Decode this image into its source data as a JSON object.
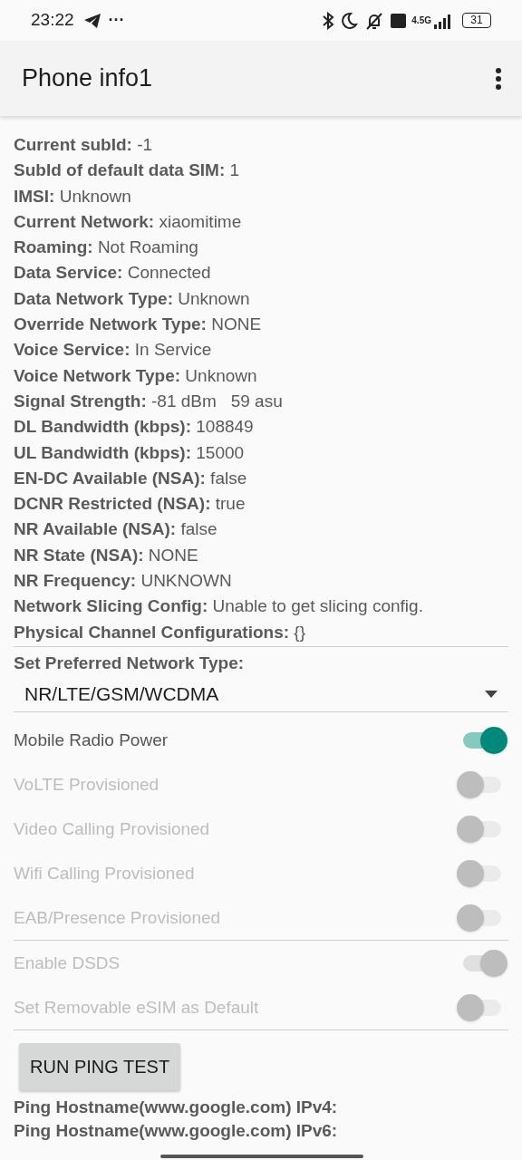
{
  "status_bar": {
    "time": "23:22",
    "more": "···",
    "battery": "31",
    "network": "4.5G"
  },
  "app_bar": {
    "title": "Phone info1"
  },
  "info": [
    {
      "label": "Current subId:",
      "value": "-1"
    },
    {
      "label": "SubId of default data SIM:",
      "value": "1"
    },
    {
      "label": "IMSI:",
      "value": "Unknown"
    },
    {
      "label": "Current Network:",
      "value": "xiaomitime"
    },
    {
      "label": "Roaming:",
      "value": "Not Roaming"
    },
    {
      "label": "Data Service:",
      "value": "Connected"
    },
    {
      "label": "Data Network Type:",
      "value": "Unknown"
    },
    {
      "label": "Override Network Type:",
      "value": "NONE"
    },
    {
      "label": "Voice Service:",
      "value": "In Service"
    },
    {
      "label": "Voice Network Type:",
      "value": "Unknown"
    },
    {
      "label": "Signal Strength:",
      "value": "-81 dBm   59 asu"
    },
    {
      "label": "DL Bandwidth (kbps):",
      "value": "108849"
    },
    {
      "label": "UL Bandwidth (kbps):",
      "value": "15000"
    },
    {
      "label": "EN-DC Available (NSA):",
      "value": "false"
    },
    {
      "label": "DCNR Restricted (NSA):",
      "value": "true"
    },
    {
      "label": "NR Available (NSA):",
      "value": "false"
    },
    {
      "label": "NR State (NSA):",
      "value": "NONE"
    },
    {
      "label": "NR Frequency:",
      "value": "UNKNOWN"
    },
    {
      "label": "Network Slicing Config:",
      "value": "Unable to get slicing config."
    },
    {
      "label": "Physical Channel Configurations:",
      "value": "{}"
    }
  ],
  "preferred_network": {
    "label": "Set Preferred Network Type:",
    "value": "NR/LTE/GSM/WCDMA"
  },
  "switch_groups": [
    [
      {
        "label": "Mobile Radio Power",
        "on": true,
        "disabled": false
      },
      {
        "label": "VoLTE Provisioned",
        "on": false,
        "disabled": true
      },
      {
        "label": "Video Calling Provisioned",
        "on": false,
        "disabled": true
      },
      {
        "label": "Wifi Calling Provisioned",
        "on": false,
        "disabled": true
      },
      {
        "label": "EAB/Presence Provisioned",
        "on": false,
        "disabled": true
      }
    ],
    [
      {
        "label": "Enable DSDS",
        "on": true,
        "disabled": true
      },
      {
        "label": "Set Removable eSIM as Default",
        "on": false,
        "disabled": true
      }
    ]
  ],
  "ping_button": "RUN PING TEST",
  "ping_results": [
    "Ping Hostname(www.google.com) IPv4:",
    "Ping Hostname(www.google.com) IPv6:"
  ]
}
